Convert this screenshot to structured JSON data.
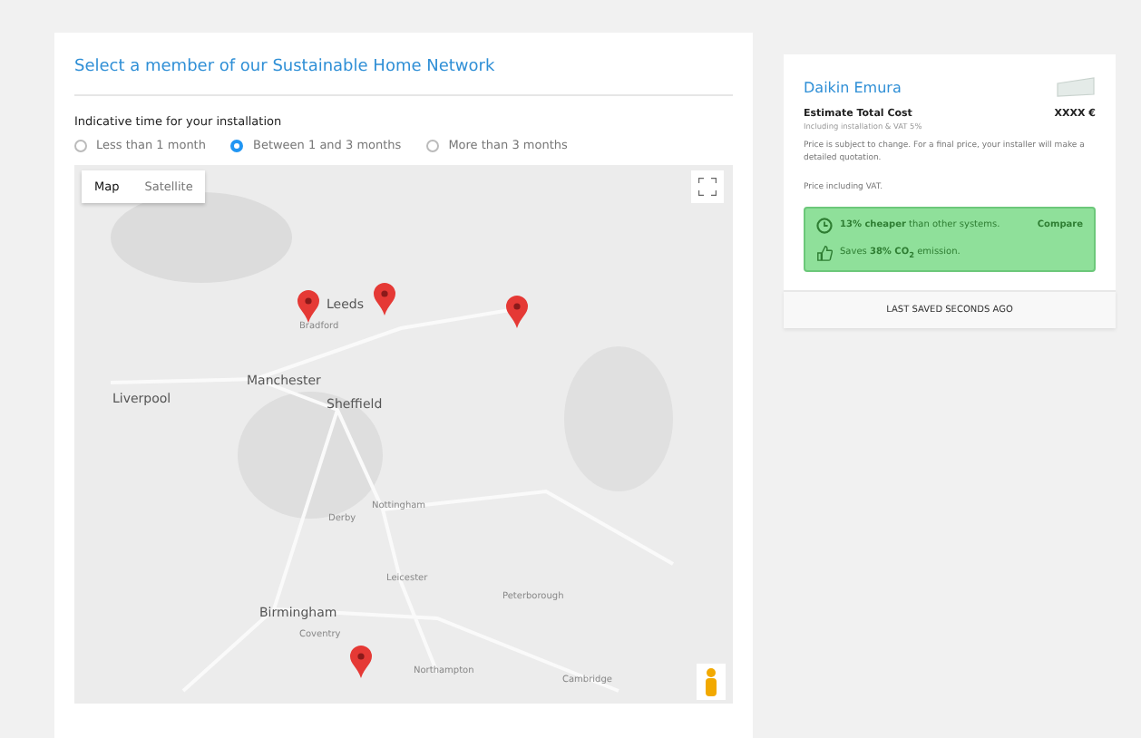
{
  "network": {
    "title": "Select a member of our Sustainable Home Network",
    "installation_time": {
      "label": "Indicative time for your installation",
      "options": [
        {
          "label": "Less than 1 month",
          "selected": false
        },
        {
          "label": "Between 1 and 3 months",
          "selected": true
        },
        {
          "label": "More than 3 months",
          "selected": false
        }
      ]
    },
    "map": {
      "types": [
        {
          "label": "Map",
          "selected": true
        },
        {
          "label": "Satellite",
          "selected": false
        }
      ],
      "places": [
        "Leeds",
        "Bradford",
        "Manchester",
        "Liverpool",
        "Sheffield",
        "Nottingham",
        "Derby",
        "Leicester",
        "Birmingham",
        "Coventry",
        "Northampton",
        "Peterborough",
        "Cambridge"
      ]
    }
  },
  "summary": {
    "product": "Daikin Emura",
    "cost_label": "Estimate Total Cost",
    "cost_value": "XXXX €",
    "cost_note": "Including installation & VAT 5%",
    "disclaimer": "Price is subject to change. For a final price, your installer will make a detailed quotation.",
    "vat_note": "Price including VAT.",
    "benefits": [
      {
        "kind": "clock",
        "text": "**13% cheaper** than other systems.",
        "link": "Compare"
      },
      {
        "kind": "thumb",
        "text": "Saves **38% CO$_{2}$** emission."
      }
    ],
    "status": "LAST SAVED SECONDS AGO"
  }
}
